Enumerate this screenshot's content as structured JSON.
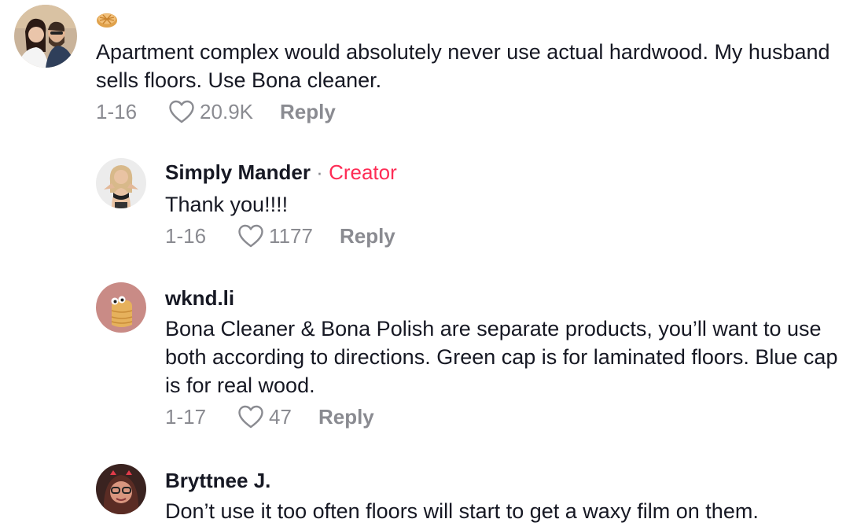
{
  "comments": [
    {
      "username": "",
      "badge_emoji": "pie-emoji",
      "text": "Apartment complex would absolutely never use actual hardwood. My husband sells floors. Use Bona cleaner.",
      "date": "1-16",
      "likes": "20.9K",
      "reply_label": "Reply"
    },
    {
      "username": "Simply Mander",
      "creator_separator": "·",
      "creator_label": "Creator",
      "text": "Thank you!!!!",
      "date": "1-16",
      "likes": "1177",
      "reply_label": "Reply"
    },
    {
      "username": "wknd.li",
      "text": "Bona Cleaner & Bona Polish are separate products, you’ll want to use both according to directions. Green cap is for laminated floors. Blue cap is for real wood.",
      "date": "1-17",
      "likes": "47",
      "reply_label": "Reply"
    },
    {
      "username": "Bryttnee J.",
      "text": "Don’t use it too often floors will start to get a waxy film on them."
    }
  ],
  "colors": {
    "creator": "#fe2c55",
    "muted": "#8a8b91",
    "text": "#161823"
  },
  "icons": [
    "heart-outline-icon",
    "pie-emoji"
  ]
}
